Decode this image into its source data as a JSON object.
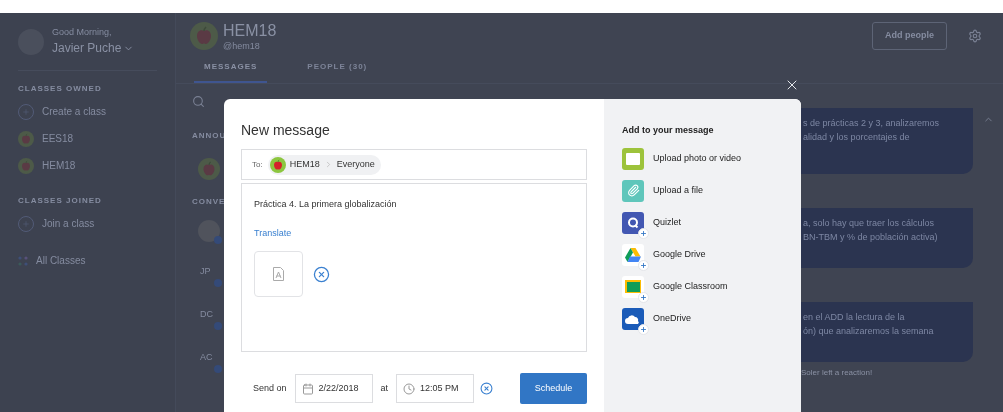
{
  "sidebar": {
    "greeting": "Good Morning,",
    "user_name": "Javier Puche",
    "sections": [
      {
        "heading": "CLASSES OWNED",
        "items": [
          {
            "kind": "create",
            "label": "Create a class"
          },
          {
            "kind": "class",
            "label": "EES18"
          },
          {
            "kind": "class",
            "label": "HEM18"
          }
        ]
      },
      {
        "heading": "CLASSES JOINED",
        "items": [
          {
            "kind": "create",
            "label": "Join a class"
          }
        ]
      }
    ],
    "all_classes": "All Classes"
  },
  "class_header": {
    "name": "HEM18",
    "handle": "@hem18",
    "add_people": "Add people"
  },
  "tabs": [
    {
      "label": "MESSAGES",
      "selected": true
    },
    {
      "label": "PEOPLE (30)",
      "selected": false
    }
  ],
  "left_column": {
    "section_labels": [
      "ANNOU",
      "CONVE"
    ],
    "conversations": [
      {
        "kind": "photo"
      },
      {
        "kind": "initials",
        "initials": "JP"
      },
      {
        "kind": "initials",
        "initials": "DC"
      },
      {
        "kind": "initials",
        "initials": "AC"
      }
    ]
  },
  "feed": {
    "posts": [
      {
        "lines": [
          "s de prácticas 2 y 3, analizaremos",
          "alidad y los porcentajes de"
        ]
      },
      {
        "lines": [
          "a, solo hay que traer los cálculos",
          "BN-TBM y % de población activa)"
        ]
      },
      {
        "lines": [
          "en el ADD la lectura de la",
          "ón) que analizaremos la semana"
        ]
      }
    ],
    "reaction": "Soler left a reaction!"
  },
  "modal": {
    "title": "New message",
    "to_label": "To:",
    "recipient_class": "HEM18",
    "recipient_group": "Everyone",
    "body": "Práctica 4. La primera globalización",
    "translate": "Translate",
    "attachments": [
      {
        "kind": "pdf"
      }
    ],
    "send_on_label": "Send on",
    "date": "2/22/2018",
    "at_label": "at",
    "time": "12:05 PM",
    "schedule": "Schedule"
  },
  "add_panel": {
    "title": "Add to your message",
    "options": [
      {
        "kind": "photo",
        "label": "Upload photo or video"
      },
      {
        "kind": "file",
        "label": "Upload a file"
      },
      {
        "kind": "quizlet",
        "label": "Quizlet"
      },
      {
        "kind": "drive",
        "label": "Google Drive"
      },
      {
        "kind": "classroom",
        "label": "Google Classroom"
      },
      {
        "kind": "onedrive",
        "label": "OneDrive"
      }
    ]
  }
}
